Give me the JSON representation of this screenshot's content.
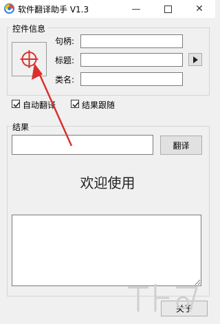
{
  "window": {
    "title": "软件翻译助手 V1.3",
    "icon": "app-icon",
    "controls": [
      "minimize-icon",
      "maximize-icon",
      "close-icon"
    ]
  },
  "controls_group": {
    "label": "控件信息",
    "target_icon": "crosshair-target-icon",
    "fields": [
      {
        "label": "句柄:",
        "value": ""
      },
      {
        "label": "标题:",
        "value": ""
      },
      {
        "label": "类名:",
        "value": ""
      }
    ],
    "arrow_button_icon": "play-arrow-icon"
  },
  "options": {
    "auto_translate": {
      "label": "自动翻译",
      "checked": true
    },
    "follow_result": {
      "label": "结果跟随",
      "checked": true
    }
  },
  "result_group": {
    "label": "结果",
    "input_value": "",
    "translate_button": "翻译",
    "welcome_text": "欢迎使用",
    "output_text": ""
  },
  "footer": {
    "about_button": "关于"
  },
  "colors": {
    "accent_red": "#d9302c",
    "window_bg": "#f0f0f0"
  }
}
